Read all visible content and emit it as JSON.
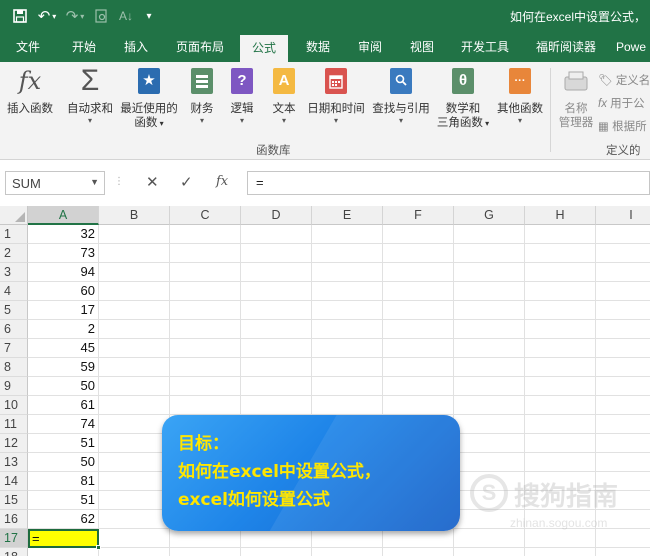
{
  "window": {
    "title": "如何在excel中设置公式，"
  },
  "quick_access": {
    "save_icon": "save-icon",
    "undo_icon": "undo-icon",
    "redo_icon": "redo-icon"
  },
  "tabs": [
    "文件",
    "开始",
    "插入",
    "页面布局",
    "公式",
    "数据",
    "审阅",
    "视图",
    "开发工具",
    "福昕阅读器",
    "Powe"
  ],
  "active_tab": "公式",
  "ribbon": {
    "insert_function": "插入函数",
    "autosum": "自动求和",
    "recent_line1": "最近使用的",
    "recent_line2": "函数",
    "financial": "财务",
    "logical": "逻辑",
    "text": "文本",
    "datetime": "日期和时间",
    "lookup": "查找与引用",
    "math_line1": "数学和",
    "math_line2": "三角函数",
    "more": "其他函数",
    "group_label": "函数库",
    "name_mgr_line1": "名称",
    "name_mgr_line2": "管理器",
    "define_name": "定义名",
    "use_in_formula": "用于公",
    "create_from_sel": "根据所",
    "defined_names_label": "定义的名",
    "glyph_fx": "fx",
    "glyph_sigma": "Σ",
    "glyph_star": "★",
    "glyph_q": "?",
    "glyph_a": "A",
    "glyph_theta": "θ",
    "glyph_dots": "···"
  },
  "formula_bar": {
    "name_box": "SUM",
    "cancel": "✕",
    "enter": "✓",
    "fx": "fx",
    "formula": "="
  },
  "columns": [
    "A",
    "B",
    "C",
    "D",
    "E",
    "F",
    "G",
    "H",
    "I"
  ],
  "rows": [
    "1",
    "2",
    "3",
    "4",
    "5",
    "6",
    "7",
    "8",
    "9",
    "10",
    "11",
    "12",
    "13",
    "14",
    "15",
    "16",
    "17",
    "18"
  ],
  "column_a_values": [
    "32",
    "73",
    "94",
    "60",
    "17",
    "2",
    "45",
    "59",
    "50",
    "61",
    "74",
    "51",
    "50",
    "81",
    "51",
    "62"
  ],
  "active_cell": {
    "ref": "A17",
    "value": "="
  },
  "callout": {
    "line1": "目标：",
    "line2": "如何在excel中设置公式，",
    "line3": "excel如何设置公式"
  },
  "watermark": {
    "name": "搜狗指南",
    "url": "zhinan.sogou.com"
  },
  "colors": {
    "excel_green": "#217346",
    "active_fill": "#ffff00",
    "callout_text": "#ffe600"
  }
}
